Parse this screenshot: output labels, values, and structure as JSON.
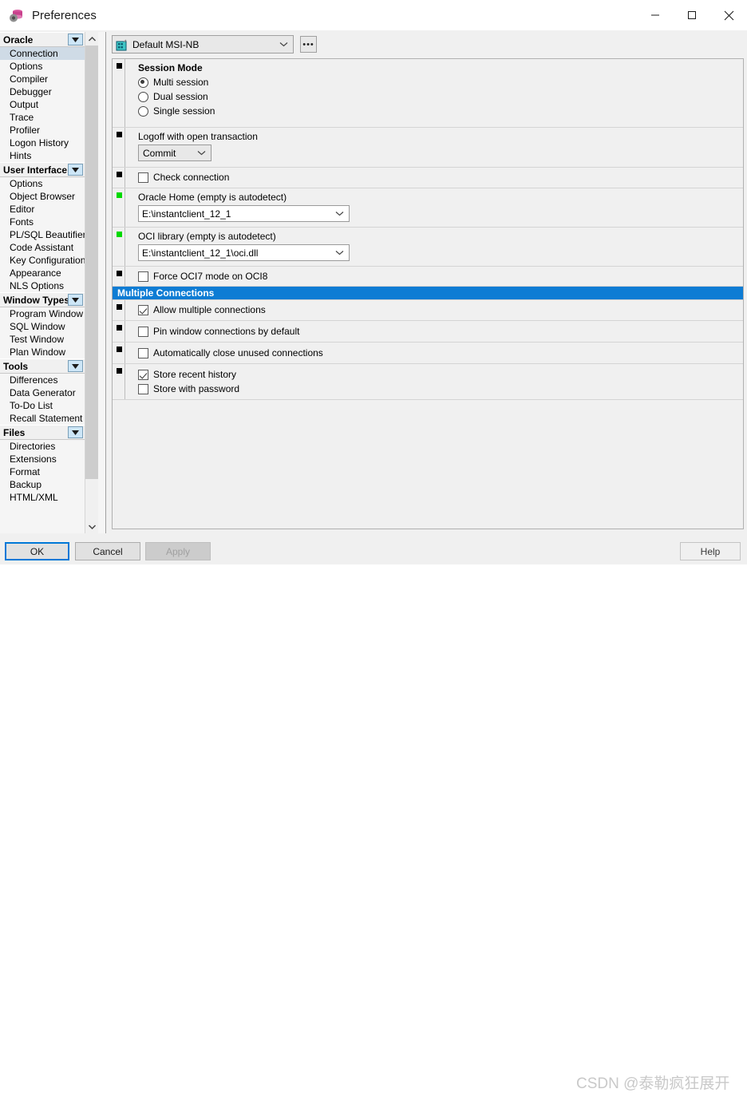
{
  "window": {
    "title": "Preferences",
    "icon": "database-gear-icon",
    "minimize_label": "─",
    "maximize_label": "□",
    "close_label": "✕"
  },
  "sidebar": {
    "groups": [
      {
        "label": "Oracle",
        "expander": "▼",
        "items": [
          {
            "label": "Connection",
            "selected": true
          },
          {
            "label": "Options",
            "selected": false
          },
          {
            "label": "Compiler",
            "selected": false
          },
          {
            "label": "Debugger",
            "selected": false
          },
          {
            "label": "Output",
            "selected": false
          },
          {
            "label": "Trace",
            "selected": false
          },
          {
            "label": "Profiler",
            "selected": false
          },
          {
            "label": "Logon History",
            "selected": false
          },
          {
            "label": "Hints",
            "selected": false
          }
        ]
      },
      {
        "label": "User Interface",
        "expander": "▼",
        "items": [
          {
            "label": "Options",
            "selected": false
          },
          {
            "label": "Object Browser",
            "selected": false
          },
          {
            "label": "Editor",
            "selected": false
          },
          {
            "label": "Fonts",
            "selected": false
          },
          {
            "label": "PL/SQL Beautifier",
            "selected": false
          },
          {
            "label": "Code Assistant",
            "selected": false
          },
          {
            "label": "Key Configuration",
            "selected": false
          },
          {
            "label": "Appearance",
            "selected": false
          },
          {
            "label": "NLS Options",
            "selected": false
          }
        ]
      },
      {
        "label": "Window Types",
        "expander": "▼",
        "items": [
          {
            "label": "Program Window",
            "selected": false
          },
          {
            "label": "SQL Window",
            "selected": false
          },
          {
            "label": "Test Window",
            "selected": false
          },
          {
            "label": "Plan Window",
            "selected": false
          }
        ]
      },
      {
        "label": "Tools",
        "expander": "▼",
        "items": [
          {
            "label": "Differences",
            "selected": false
          },
          {
            "label": "Data Generator",
            "selected": false
          },
          {
            "label": "To-Do List",
            "selected": false
          },
          {
            "label": "Recall Statement",
            "selected": false
          }
        ]
      },
      {
        "label": "Files",
        "expander": "▼",
        "items": [
          {
            "label": "Directories",
            "selected": false
          },
          {
            "label": "Extensions",
            "selected": false
          },
          {
            "label": "Format",
            "selected": false
          },
          {
            "label": "Backup",
            "selected": false
          },
          {
            "label": "HTML/XML",
            "selected": false
          }
        ]
      }
    ],
    "scrollbar": {
      "up_arrow": "⌃",
      "down_arrow": "⌄"
    }
  },
  "content": {
    "profile": {
      "icon": "connection-profile-icon",
      "value": "Default MSI-NB",
      "arrow": "⌄",
      "more_button": "•••"
    },
    "session_mode": {
      "title": "Session Mode",
      "options": [
        {
          "label": "Multi session",
          "checked": true
        },
        {
          "label": "Dual session",
          "checked": false
        },
        {
          "label": "Single session",
          "checked": false
        }
      ]
    },
    "logoff": {
      "label": "Logoff with open transaction",
      "value": "Commit",
      "arrow": "⌄"
    },
    "check_connection": {
      "label": "Check connection",
      "checked": false
    },
    "oracle_home": {
      "label": "Oracle Home (empty is autodetect)",
      "value": "E:\\instantclient_12_1",
      "arrow": "⌄"
    },
    "oci_library": {
      "label": "OCI library (empty is autodetect)",
      "value": "E:\\instantclient_12_1\\oci.dll",
      "arrow": "⌄"
    },
    "force_oci7": {
      "label": "Force OCI7 mode on OCI8",
      "checked": false
    },
    "multiple_connections_header": "Multiple Connections",
    "allow_multiple": {
      "label": "Allow multiple connections",
      "checked": true
    },
    "pin_window": {
      "label": "Pin window connections by default",
      "checked": false
    },
    "auto_close": {
      "label": "Automatically close unused connections",
      "checked": false
    },
    "store_recent": {
      "label": "Store recent history",
      "checked": true
    },
    "store_password": {
      "label": "Store with password",
      "checked": false
    }
  },
  "footer": {
    "ok": "OK",
    "cancel": "Cancel",
    "apply": "Apply",
    "help": "Help",
    "watermark": "CSDN @泰勒疯狂展开"
  },
  "colors": {
    "accent": "#0d7cd4",
    "focus": "#0078d7",
    "selection": "#cfdbe6",
    "indicator_green": "#00d900",
    "indicator_black": "#000000"
  }
}
